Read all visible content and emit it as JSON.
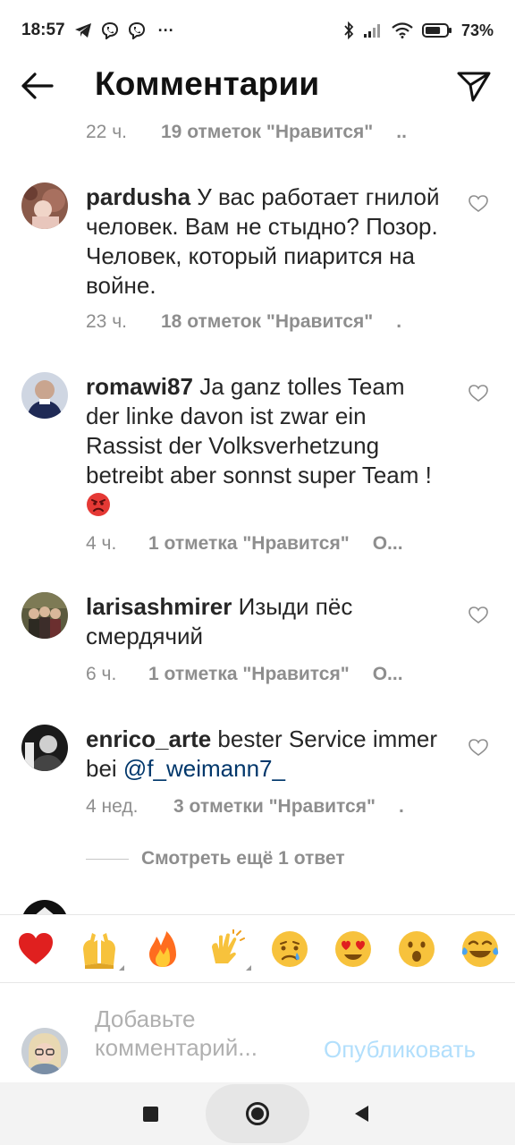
{
  "status_bar": {
    "time": "18:57",
    "more": "···",
    "battery": "73%",
    "battery_level": 0.73
  },
  "header": {
    "title": "Комментарии"
  },
  "comments": [
    {
      "time": "22 ч.",
      "likes": "19 отметок \"Нравится\"",
      "reply": "..",
      "partial_top": true
    },
    {
      "username": "pardusha",
      "text": "У вас работает гнилой человек. Вам не стыдно?  Позор. Человек, который пиарится на войне.",
      "time": "23 ч.",
      "likes": "18 отметок \"Нравится\"",
      "reply": "."
    },
    {
      "username": "romawi87",
      "text": "Ja ganz tolles Team der linke davon ist zwar ein Rassist der Volksverhetzung betreibt aber sonnst super Team !",
      "emoji": "angry-face",
      "time": "4 ч.",
      "likes": "1 отметка \"Нравится\"",
      "reply": "О..."
    },
    {
      "username": "larisashmirer",
      "text": "Изыди  пёс смердячий",
      "time": "6 ч.",
      "likes": "1 отметка \"Нравится\"",
      "reply": "О..."
    },
    {
      "username": "enrico_arte",
      "text": "bester Service immer bei ",
      "mention": "@f_weimann7_",
      "time": "4 нед.",
      "likes": "3 отметки \"Нравится\"",
      "reply": "."
    }
  ],
  "view_more": "Смотреть ещё 1 ответ",
  "emoji_bar": [
    "red-heart",
    "raising-hands",
    "fire",
    "clapping-hands",
    "crying-face",
    "heart-eyes",
    "surprised-face",
    "tears-of-joy"
  ],
  "input": {
    "placeholder_line1": "Добавьте",
    "placeholder_line2": "комментарий...",
    "publish": "Опубликовать"
  },
  "colors": {
    "accent_disabled": "#b2dffc",
    "mention": "#00376b",
    "meta": "#8e8e8e"
  }
}
